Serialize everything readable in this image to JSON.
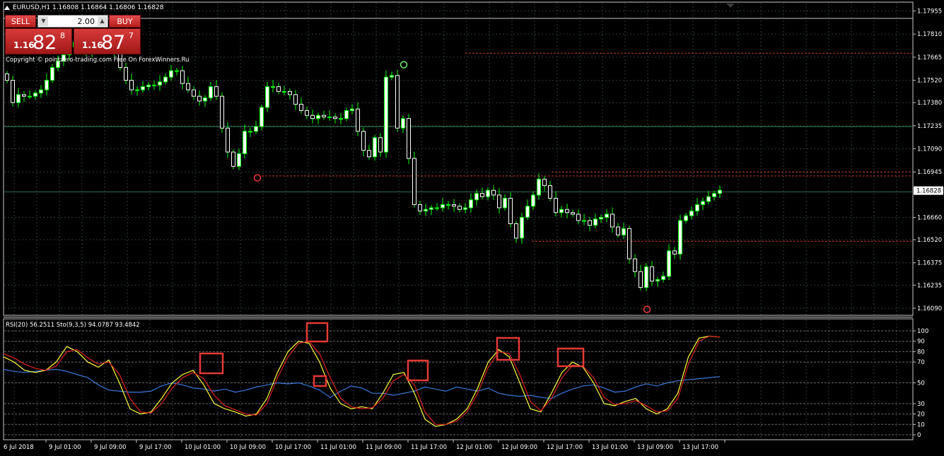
{
  "header": {
    "symbol_info": "EURUSD,H1  1.16808 1.16864 1.16806 1.16828"
  },
  "trade_panel": {
    "sell_label": "SELL",
    "buy_label": "BUY",
    "lot": "2.00",
    "sell_price": {
      "prefix": "1.16",
      "big": "82",
      "sup": "8"
    },
    "buy_price": {
      "prefix": "1.16",
      "big": "87",
      "sup": "7"
    }
  },
  "copyright": "Copyright © pointzero-trading.com  Free On ForexWinners.Ru",
  "price_axis": {
    "labels": [
      "1.17955",
      "1.17810",
      "1.17665",
      "1.17520",
      "1.17380",
      "1.17235",
      "1.17090",
      "1.16945",
      "1.16660",
      "1.16520",
      "1.16375",
      "1.16235",
      "1.16090"
    ],
    "current_price": "1.16828"
  },
  "indicator": {
    "label": "RSI(20) 56.2511  Sto(9,3,5) 94.0787 93.4842"
  },
  "indicator_axis": {
    "labels": [
      "100",
      "90",
      "80",
      "70",
      "50",
      "30",
      "20",
      "10",
      "0"
    ]
  },
  "time_axis": {
    "labels": [
      "6 Jul 2018",
      "9 Jul 01:00",
      "9 Jul 09:00",
      "9 Jul 17:00",
      "10 Jul 01:00",
      "10 Jul 09:00",
      "10 Jul 17:00",
      "11 Jul 01:00",
      "11 Jul 09:00",
      "11 Jul 17:00",
      "12 Jul 01:00",
      "12 Jul 09:00",
      "12 Jul 17:00",
      "13 Jul 01:00",
      "13 Jul 09:00",
      "13 Jul 17:00"
    ]
  },
  "colors": {
    "background": "#000000",
    "bull_candle": "#ffffff",
    "bear_candle": "#ffffff",
    "wick": "#00ff00",
    "grid": "#2e3b3b",
    "resistance_line": "#c0392b",
    "ma_line": "#2e8b57",
    "rsi_line": "#3a78d8",
    "stoch_main": "#ffff3c",
    "stoch_signal": "#e02020",
    "highlight_box": "#e53935"
  },
  "chart_data": [
    {
      "type": "candlestick",
      "title": "EURUSD,H1",
      "ylim": [
        1.1609,
        1.17955
      ],
      "close": [
        1.1752,
        1.1738,
        1.1743,
        1.1742,
        1.1742,
        1.1744,
        1.1746,
        1.1752,
        1.176,
        1.1764,
        1.1768,
        1.1773,
        1.1776,
        1.1772,
        1.177,
        1.1773,
        1.1775,
        1.1777,
        1.1779,
        1.177,
        1.176,
        1.1752,
        1.1746,
        1.1746,
        1.1748,
        1.1749,
        1.1749,
        1.1751,
        1.1754,
        1.1758,
        1.1758,
        1.175,
        1.1746,
        1.1742,
        1.1739,
        1.1741,
        1.1748,
        1.1742,
        1.1722,
        1.1707,
        1.1698,
        1.1706,
        1.172,
        1.172,
        1.1723,
        1.1735,
        1.1748,
        1.1748,
        1.1745,
        1.1745,
        1.1743,
        1.1737,
        1.1733,
        1.173,
        1.1728,
        1.173,
        1.1729,
        1.1729,
        1.1728,
        1.1728,
        1.1733,
        1.1734,
        1.172,
        1.1708,
        1.1704,
        1.1716,
        1.1707,
        1.1754,
        1.1755,
        1.1722,
        1.1728,
        1.1703,
        1.1674,
        1.167,
        1.1671,
        1.1672,
        1.1672,
        1.1674,
        1.1674,
        1.1673,
        1.1671,
        1.1672,
        1.1677,
        1.1681,
        1.1679,
        1.1683,
        1.168,
        1.1672,
        1.1678,
        1.1662,
        1.1653,
        1.1666,
        1.1673,
        1.168,
        1.169,
        1.1686,
        1.1678,
        1.1669,
        1.1671,
        1.1669,
        1.1668,
        1.1664,
        1.1664,
        1.1661,
        1.1665,
        1.1666,
        1.1668,
        1.166,
        1.1655,
        1.1659,
        1.164,
        1.1632,
        1.1622,
        1.1635,
        1.1626,
        1.1627,
        1.1629,
        1.1645,
        1.1643,
        1.1664,
        1.1667,
        1.167,
        1.1674,
        1.1676,
        1.1679,
        1.1681,
        1.1683
      ],
      "lows": {
        "min_1": 1.1621,
        "min_2": 1.16105
      },
      "marked_swings": [
        {
          "kind": "high",
          "price": 1.176
        },
        {
          "kind": "low",
          "price": 1.1693
        },
        {
          "kind": "low",
          "price": 1.16105
        }
      ],
      "horizontal_levels": [
        1.1769,
        1.16945,
        1.1692,
        1.1651
      ],
      "moving_average_level": 1.1723
    },
    {
      "type": "line",
      "title": "RSI(20) 56.2511  Sto(9,3,5) 94.0787 93.4842",
      "ylim": [
        0,
        100
      ],
      "series": [
        {
          "name": "RSI(20)",
          "values": [
            63,
            61,
            60,
            61,
            62,
            63,
            61,
            58,
            55,
            48,
            43,
            42,
            41,
            41,
            42,
            47,
            50,
            48,
            45,
            44,
            42,
            44,
            41,
            43,
            46,
            48,
            50,
            49,
            50,
            47,
            43,
            36,
            42,
            47,
            45,
            40,
            40,
            38,
            40,
            42,
            46,
            44,
            42,
            46,
            44,
            42,
            45,
            40,
            38,
            37,
            38,
            36,
            35,
            40,
            44,
            47,
            48,
            45,
            41,
            42,
            46,
            49,
            47,
            50,
            52,
            53,
            54,
            55,
            56
          ]
        },
        {
          "name": "Sto(9,3,5)",
          "values": [
            75,
            70,
            62,
            60,
            62,
            70,
            85,
            80,
            70,
            65,
            72,
            50,
            25,
            20,
            22,
            35,
            50,
            58,
            62,
            48,
            30,
            25,
            22,
            18,
            20,
            35,
            60,
            80,
            90,
            88,
            70,
            45,
            30,
            25,
            27,
            25,
            40,
            58,
            60,
            40,
            15,
            8,
            10,
            15,
            25,
            45,
            70,
            82,
            75,
            50,
            25,
            22,
            40,
            60,
            70,
            65,
            50,
            30,
            28,
            32,
            35,
            25,
            20,
            25,
            40,
            75,
            93,
            95,
            94
          ]
        },
        {
          "name": "signal",
          "values": [
            78,
            74,
            68,
            64,
            62,
            66,
            80,
            82,
            74,
            68,
            70,
            58,
            35,
            22,
            21,
            30,
            45,
            55,
            60,
            54,
            38,
            28,
            24,
            20,
            19,
            30,
            55,
            75,
            88,
            90,
            78,
            55,
            35,
            27,
            25,
            26,
            35,
            52,
            58,
            48,
            22,
            10,
            10,
            13,
            22,
            40,
            65,
            80,
            78,
            58,
            32,
            23,
            35,
            55,
            67,
            66,
            55,
            36,
            29,
            30,
            33,
            28,
            22,
            23,
            35,
            68,
            90,
            95,
            94
          ]
        }
      ]
    }
  ]
}
